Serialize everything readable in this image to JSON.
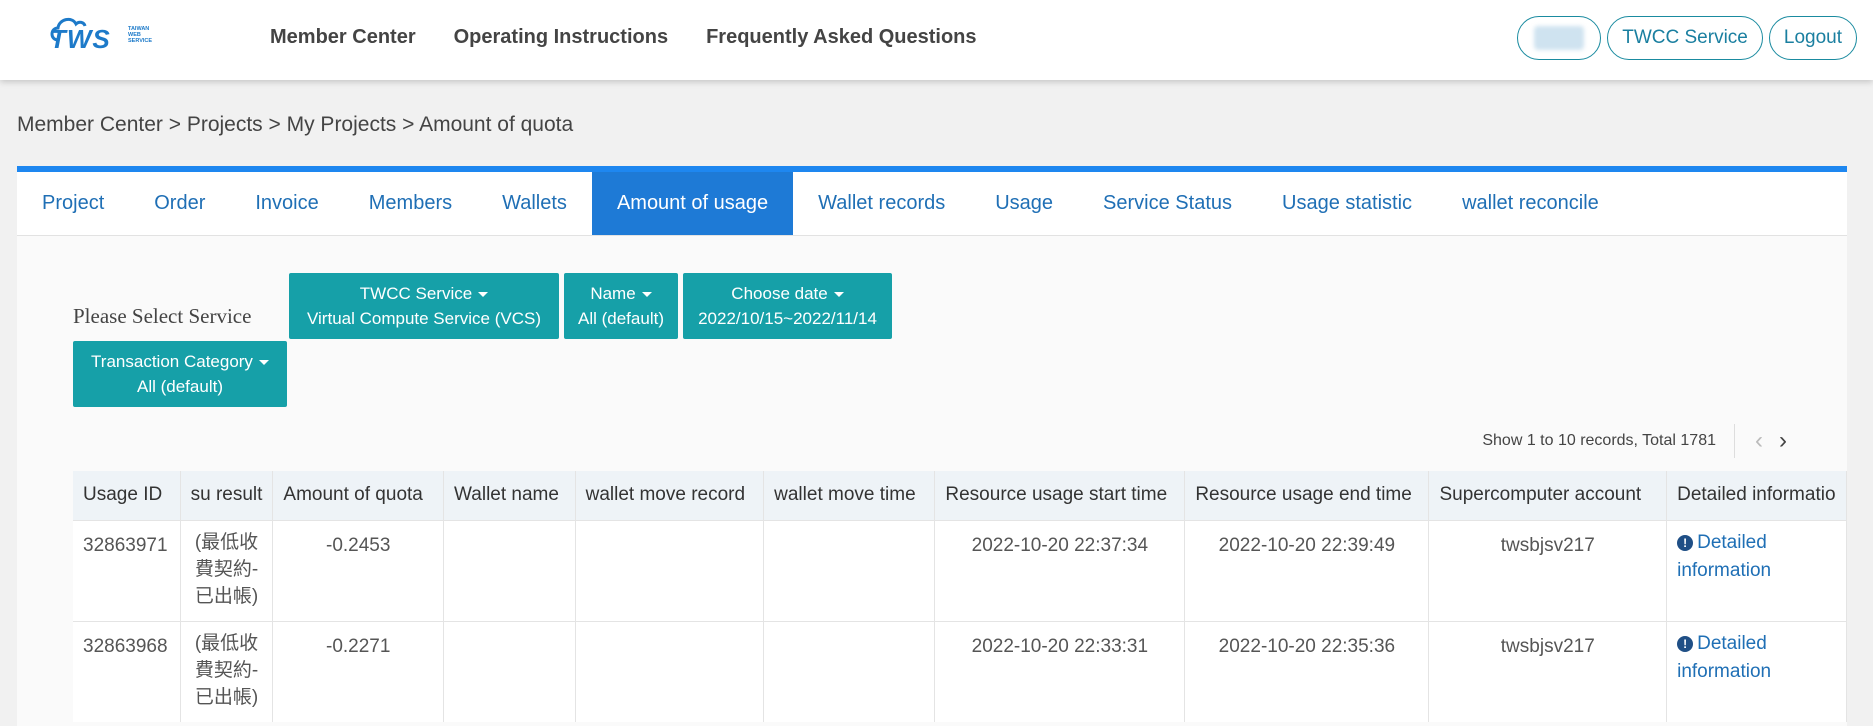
{
  "header": {
    "logo_text": "TWS",
    "logo_sub": [
      "TAIWAN",
      "WEB",
      "SERVICE"
    ],
    "nav": [
      "Member Center",
      "Operating Instructions",
      "Frequently Asked Questions"
    ],
    "service_button": "TWCC Service",
    "logout_button": "Logout"
  },
  "breadcrumb": "Member Center > Projects > My Projects > Amount of quota",
  "tabs": [
    "Project",
    "Order",
    "Invoice",
    "Members",
    "Wallets",
    "Amount of usage",
    "Wallet records",
    "Usage",
    "Service Status",
    "Usage statistic",
    "wallet reconcile"
  ],
  "active_tab": "Amount of usage",
  "filters": {
    "label": "Please Select Service",
    "service": {
      "title": "TWCC Service",
      "value": "Virtual Compute Service (VCS)"
    },
    "name": {
      "title": "Name",
      "value": "All (default)"
    },
    "date": {
      "title": "Choose date",
      "value": "2022/10/15~2022/11/14"
    },
    "category": {
      "title": "Transaction Category",
      "value": "All (default)"
    }
  },
  "records_text": "Show 1 to 10 records, Total 1781",
  "table": {
    "headers": [
      "Usage ID",
      "su result",
      "Amount of quota",
      "Wallet name",
      "wallet move record",
      "wallet move time",
      "Resource usage start time",
      "Resource usage end time",
      "Supercomputer account",
      "Detailed informatio"
    ],
    "rows": [
      {
        "id": "32863971",
        "su": [
          "(最低收",
          "費契約-",
          "已出帳)"
        ],
        "amount": "-0.2453",
        "wallet": "",
        "move_record": "",
        "move_time": "",
        "start": "2022-10-20 22:37:34",
        "end": "2022-10-20 22:39:49",
        "account": "twsbjsv217",
        "detail": [
          "Detailed",
          "information"
        ]
      },
      {
        "id": "32863968",
        "su": [
          "(最低收",
          "費契約-",
          "已出帳)"
        ],
        "amount": "-0.2271",
        "wallet": "",
        "move_record": "",
        "move_time": "",
        "start": "2022-10-20 22:33:31",
        "end": "2022-10-20 22:35:36",
        "account": "twsbjsv217",
        "detail": [
          "Detailed",
          "information"
        ]
      }
    ]
  },
  "colors": {
    "accent": "#1e7ad6",
    "teal": "#16a0a8",
    "link": "#1f6fb5"
  }
}
